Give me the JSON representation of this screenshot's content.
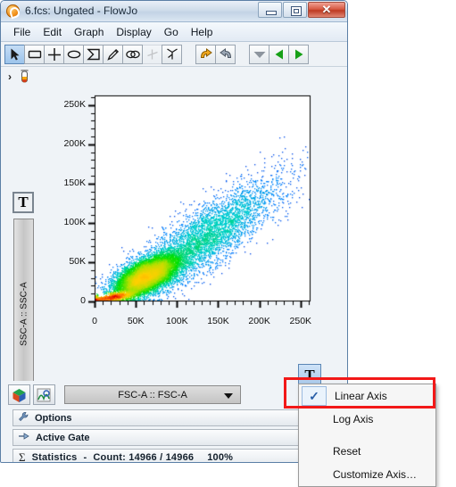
{
  "window": {
    "title": "6.fcs: Ungated - FlowJo",
    "app_icon": "flowjo-logo-icon",
    "controls": {
      "minimize": "minimize-button",
      "restore": "restore-button",
      "close_label": "✕"
    }
  },
  "menubar": {
    "items": [
      "File",
      "Edit",
      "Graph",
      "Display",
      "Go",
      "Help"
    ]
  },
  "toolbar": {
    "tools": [
      {
        "name": "pointer-tool",
        "selected": true,
        "enabled": true
      },
      {
        "name": "rectangle-gate-tool",
        "selected": false,
        "enabled": true
      },
      {
        "name": "quadrant-gate-tool",
        "selected": false,
        "enabled": true
      },
      {
        "name": "ellipse-gate-tool",
        "selected": false,
        "enabled": true
      },
      {
        "name": "polygon-gate-tool",
        "selected": false,
        "enabled": true
      },
      {
        "name": "pencil-gate-tool",
        "selected": false,
        "enabled": true
      },
      {
        "name": "boolean-gate-tool",
        "selected": false,
        "enabled": true
      },
      {
        "name": "bisector-gate-tool",
        "selected": false,
        "enabled": false
      },
      {
        "name": "spider-gate-tool",
        "selected": false,
        "enabled": true
      }
    ],
    "history": [
      {
        "name": "undo-button"
      },
      {
        "name": "redo-button"
      }
    ],
    "navigation": [
      {
        "name": "dropdown-arrow-button"
      },
      {
        "name": "previous-button"
      },
      {
        "name": "next-button"
      }
    ]
  },
  "gate_path": {
    "chevron": "›",
    "sample_icon": "test-tube-icon"
  },
  "plot": {
    "y_axis_button": "T",
    "y_axis_parameter": "SSC-A :: SSC-A",
    "x_axis_button": "T",
    "x_axis_parameter": "FSC-A :: FSC-A"
  },
  "chart_data": {
    "type": "scatter",
    "title": "",
    "xlabel": "FSC-A :: FSC-A",
    "ylabel": "SSC-A :: SSC-A",
    "xlim": [
      0,
      262144
    ],
    "ylim": [
      0,
      262144
    ],
    "xticks": [
      0,
      50000,
      100000,
      150000,
      200000,
      250000
    ],
    "yticks": [
      0,
      50000,
      100000,
      150000,
      200000,
      250000
    ],
    "xticklabels": [
      "0",
      "50K",
      "100K",
      "150K",
      "200K",
      "250K"
    ],
    "yticklabels": [
      "0",
      "50K",
      "100K",
      "150K",
      "200K",
      "250K"
    ],
    "minor_ticks_per_major": 5,
    "grid": false,
    "legend": "none",
    "point_count": 14966,
    "density_colormap": [
      "#0000cc",
      "#0080ff",
      "#00d0d0",
      "#00e000",
      "#b0e000",
      "#ffd000",
      "#ff7000",
      "#e00000"
    ],
    "populations": [
      {
        "name": "debris-diagonal",
        "x_mean": 20000,
        "y_mean": 6000,
        "x_sd": 14000,
        "y_sd": 2500,
        "corr": 0.93,
        "fraction": 0.18
      },
      {
        "name": "main-cluster",
        "x_mean": 62000,
        "y_mean": 33000,
        "x_sd": 20000,
        "y_sd": 14000,
        "corr": 0.62,
        "fraction": 0.52
      },
      {
        "name": "diagonal-tail",
        "x_mean": 130000,
        "y_mean": 78000,
        "x_sd": 48000,
        "y_sd": 38000,
        "corr": 0.85,
        "fraction": 0.3
      }
    ]
  },
  "bottom": {
    "buttons": [
      {
        "name": "color-cube-button"
      },
      {
        "name": "overlay-button"
      }
    ],
    "panels": [
      {
        "name": "options-panel",
        "icon": "wrench-icon",
        "label": "Options"
      },
      {
        "name": "active-gate-panel",
        "icon": "gate-icon",
        "label": "Active Gate"
      }
    ],
    "statistics": {
      "icon": "sigma-icon",
      "label": "Statistics",
      "separator": "-",
      "count_label": "Count: 14966 / 14966",
      "percent": "100%"
    }
  },
  "context_menu": {
    "items": [
      {
        "label": "Linear Axis",
        "checked": true
      },
      {
        "label": "Log Axis",
        "checked": false
      },
      {
        "label": "Reset",
        "checked": false
      },
      {
        "label": "Customize Axis…",
        "checked": false
      }
    ],
    "highlight_color": "#f21818"
  }
}
